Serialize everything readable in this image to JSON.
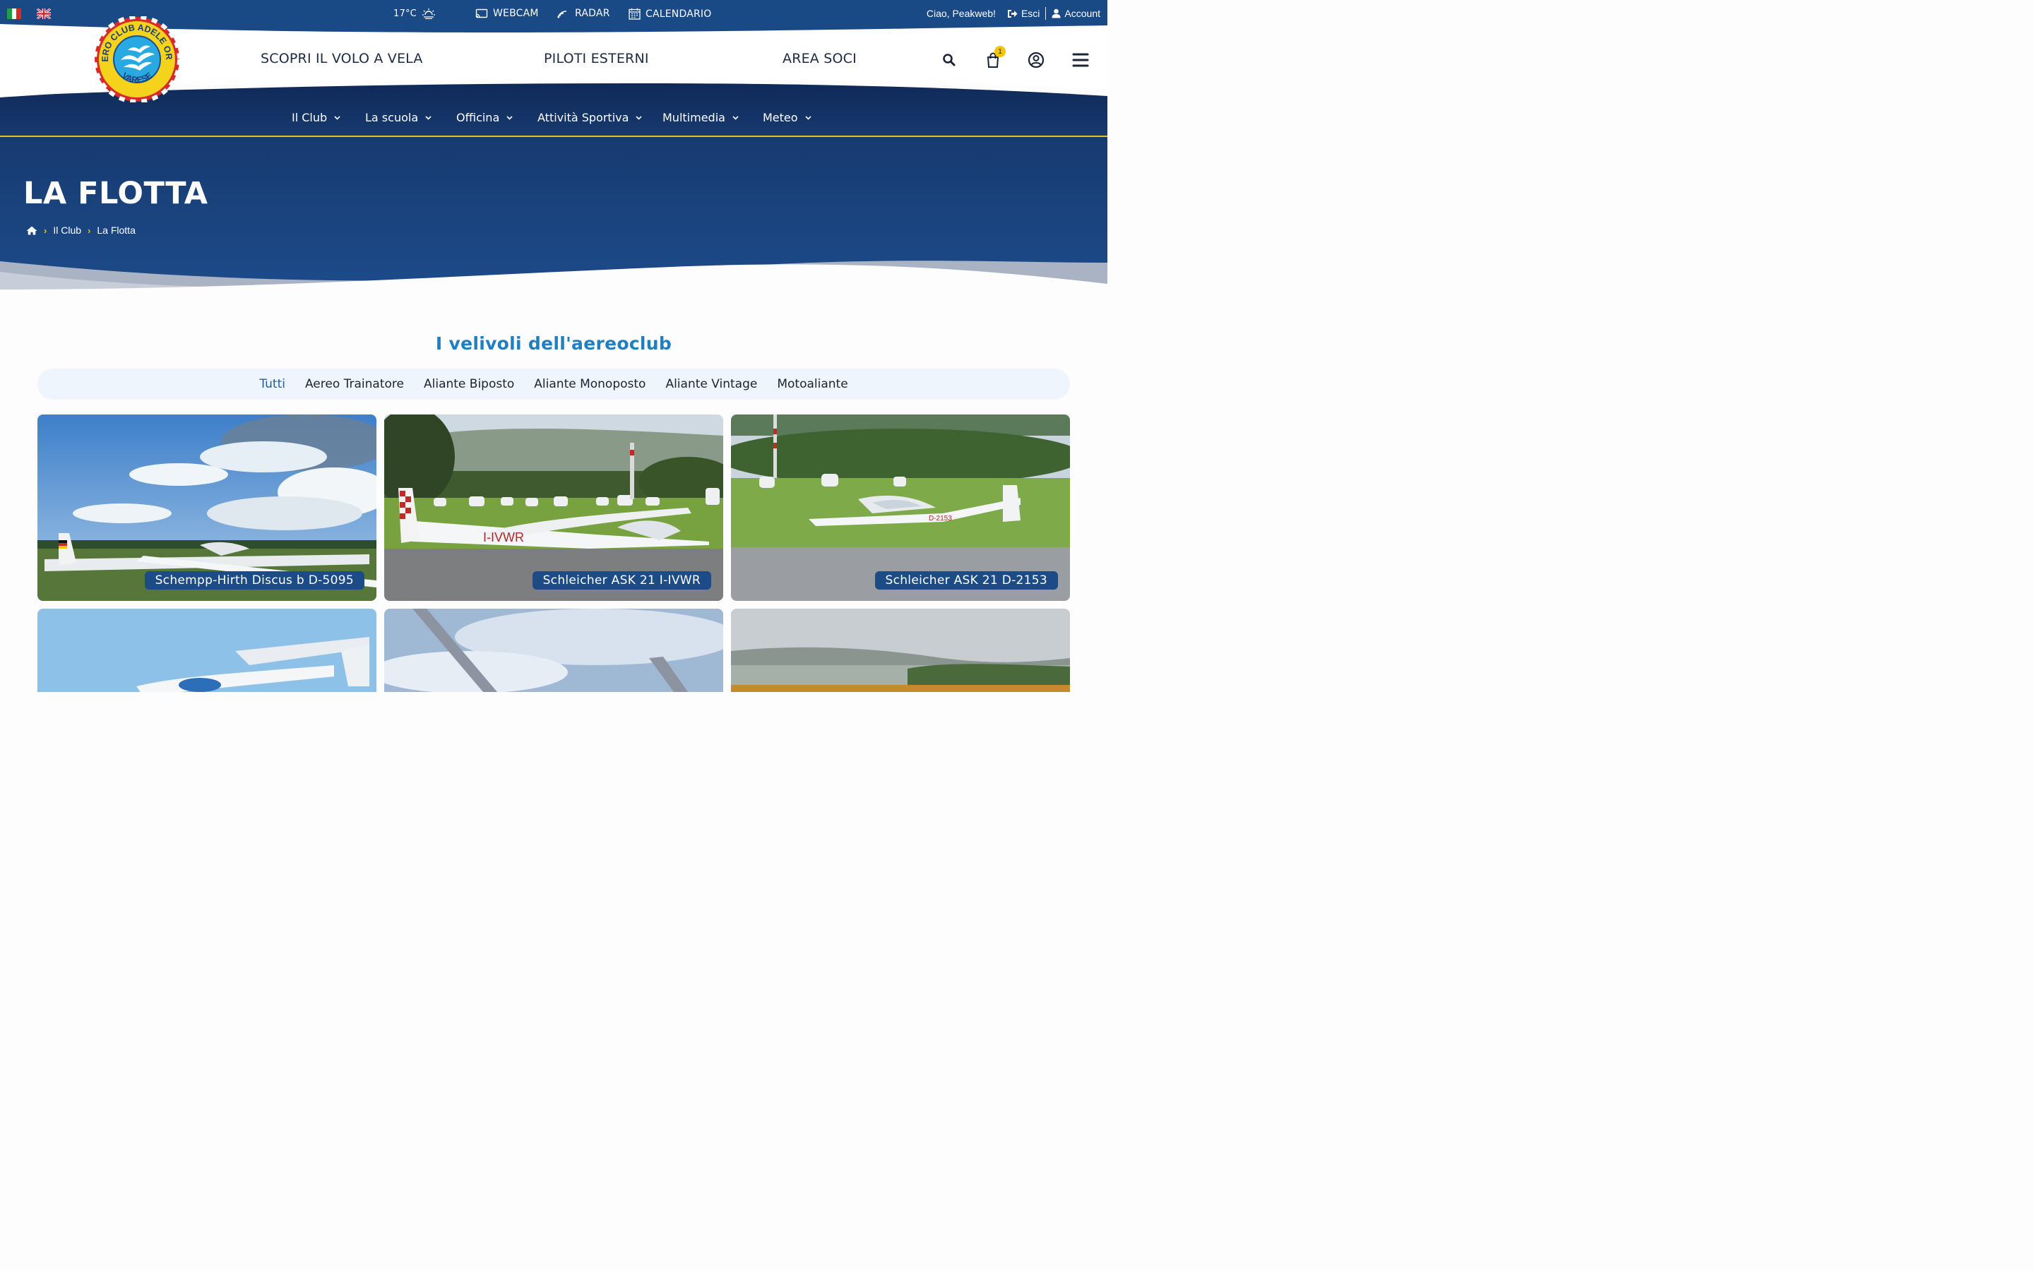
{
  "topbar": {
    "languages": [
      "Italiano",
      "English"
    ],
    "temperature": "17°C",
    "weather_icon": "sun-fog-icon",
    "webcam_label": "WEBCAM",
    "radar_label": "RADAR",
    "calendar_label": "CALENDARIO",
    "greeting": "Ciao, Peakweb!",
    "logout_label": "Esci",
    "account_label": "Account"
  },
  "logo": {
    "text_top": "AERO CLUB ADELE ORSI",
    "text_bottom": "VARESE"
  },
  "main_nav": {
    "items": [
      "SCOPRI IL VOLO A VELA",
      "PILOTI ESTERNI",
      "AREA SOCI"
    ]
  },
  "header_icons": {
    "cart_count": "1"
  },
  "sub_nav": {
    "items": [
      "Il Club",
      "La scuola",
      "Officina",
      "Attività Sportiva",
      "Multimedia",
      "Meteo"
    ]
  },
  "hero": {
    "title": "LA FLOTTA",
    "breadcrumb": [
      "Il Club",
      "La Flotta"
    ]
  },
  "fleet": {
    "title": "I velivoli dell'aereoclub",
    "filters": [
      "Tutti",
      "Aereo Trainatore",
      "Aliante Biposto",
      "Aliante Monoposto",
      "Aliante Vintage",
      "Motoaliante"
    ],
    "active_filter": "Tutti",
    "cards": [
      {
        "caption": "Schempp-Hirth Discus b D-5095",
        "registration": "D-5095"
      },
      {
        "caption": "Schleicher ASK 21 I-IVWR",
        "registration": "I-IVWR"
      },
      {
        "caption": "Schleicher ASK 21 D-2153",
        "registration": "D-2153"
      }
    ]
  },
  "colors": {
    "navy": "#1a3e74",
    "navy_dark": "#0f2a55",
    "accent_yellow": "#e8c21a",
    "title_blue": "#1f7fc0",
    "caption_bg": "#1c4b86"
  }
}
